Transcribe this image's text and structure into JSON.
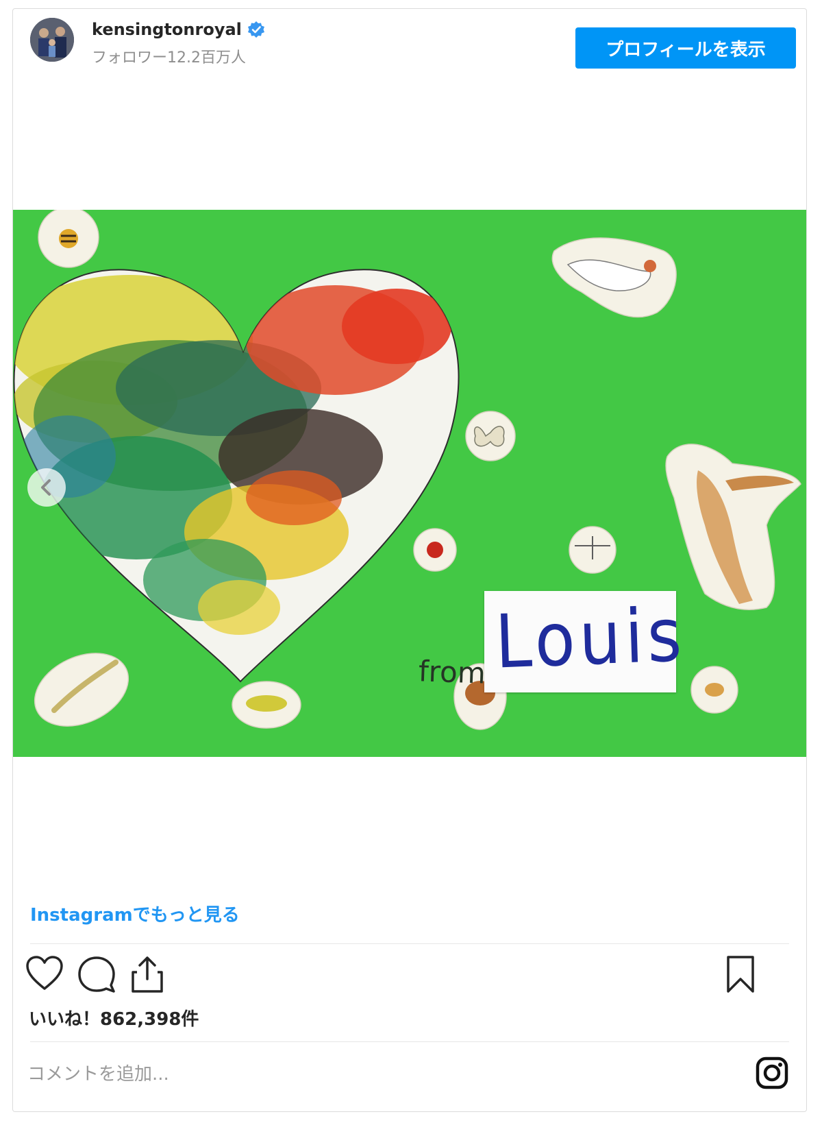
{
  "post": {
    "username": "kensingtonroyal",
    "followers": "フォロワー12.2百万人",
    "profile_button": "プロフィールを表示",
    "more_link": "Instagramでもっと見る",
    "likes": "いいね！862,398件",
    "comment_placeholder": "コメントを追加..."
  },
  "artwork": {
    "from_text": "from",
    "name_text": "Louis"
  },
  "icons": {
    "verified": "verified-badge-icon",
    "like": "heart-icon",
    "comment": "comment-icon",
    "share": "share-icon",
    "save": "bookmark-icon",
    "instagram": "instagram-icon",
    "carousel": "chevron-left-icon"
  },
  "colors": {
    "accent": "#0095f6",
    "link": "#2196f3",
    "photo_background": "#43c845"
  }
}
